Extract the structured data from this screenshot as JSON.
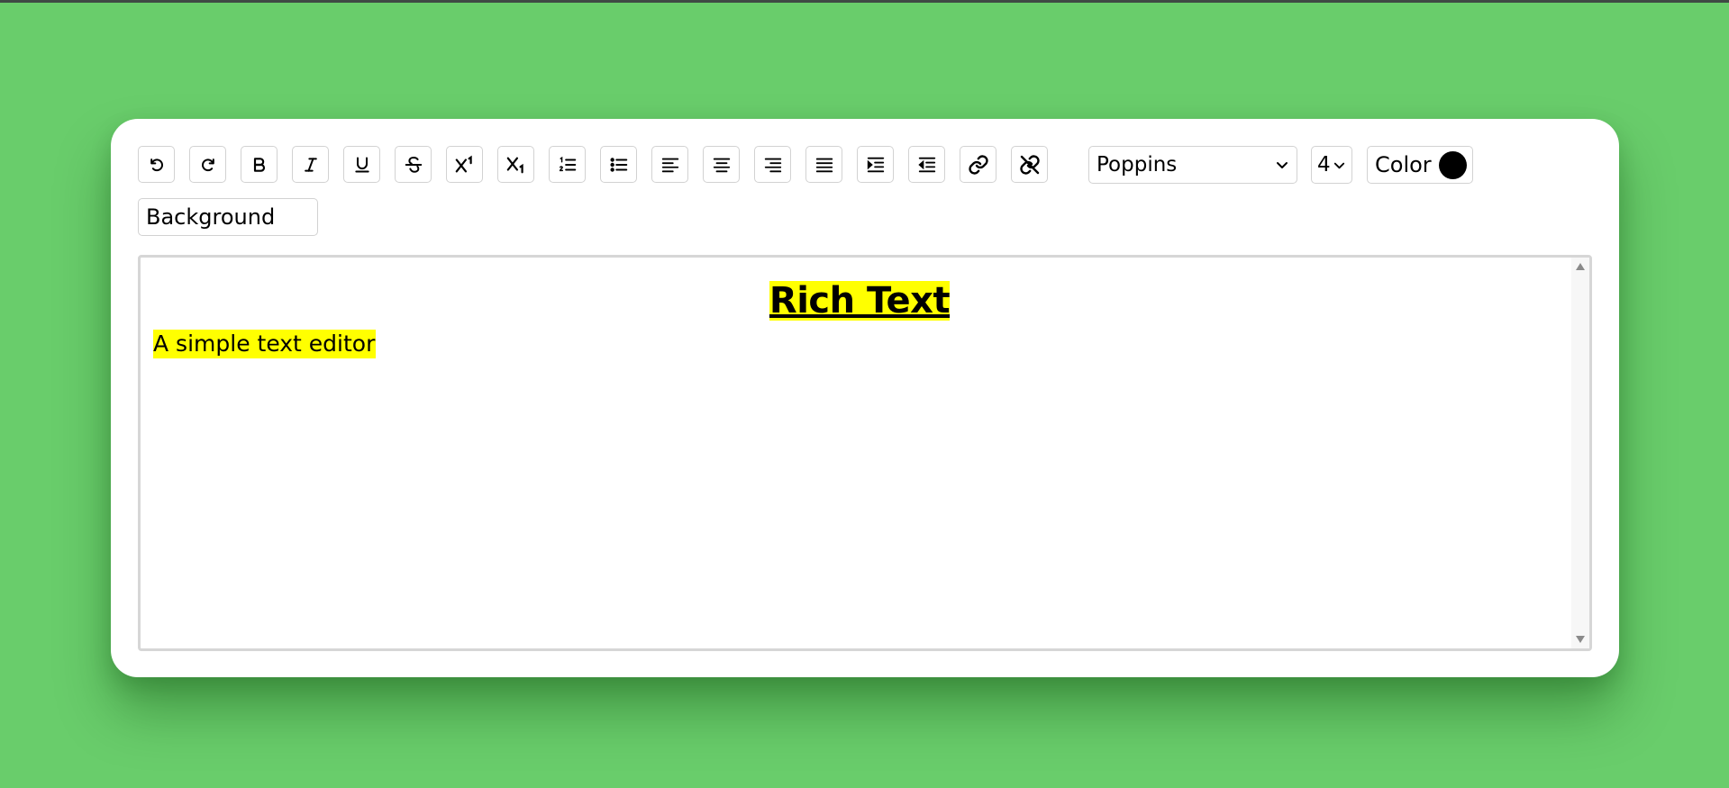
{
  "toolbar": {
    "buttons": [
      {
        "name": "undo",
        "icon": "undo-icon"
      },
      {
        "name": "redo",
        "icon": "redo-icon"
      },
      {
        "name": "bold",
        "icon": "bold-icon"
      },
      {
        "name": "italic",
        "icon": "italic-icon"
      },
      {
        "name": "underline",
        "icon": "underline-icon"
      },
      {
        "name": "strikethrough",
        "icon": "strikethrough-icon"
      },
      {
        "name": "superscript",
        "icon": "superscript-icon"
      },
      {
        "name": "subscript",
        "icon": "subscript-icon"
      },
      {
        "name": "ordered-list",
        "icon": "ordered-list-icon"
      },
      {
        "name": "unordered-list",
        "icon": "unordered-list-icon"
      },
      {
        "name": "align-left",
        "icon": "align-left-icon"
      },
      {
        "name": "align-center",
        "icon": "align-center-icon"
      },
      {
        "name": "align-right",
        "icon": "align-right-icon"
      },
      {
        "name": "justify",
        "icon": "align-justify-icon"
      },
      {
        "name": "indent",
        "icon": "indent-icon"
      },
      {
        "name": "outdent",
        "icon": "outdent-icon"
      },
      {
        "name": "link",
        "icon": "link-icon"
      },
      {
        "name": "unlink",
        "icon": "unlink-icon"
      }
    ],
    "font_name": "Poppins",
    "font_size": "4",
    "color_label": "Color",
    "color_value": "#000000",
    "background_label": "Background"
  },
  "editor": {
    "heading": "Rich Text",
    "paragraph": "A simple text editor",
    "highlight_color": "#ffff00"
  },
  "colors": {
    "page_background": "#69cd6b",
    "card_background": "#ffffff"
  }
}
